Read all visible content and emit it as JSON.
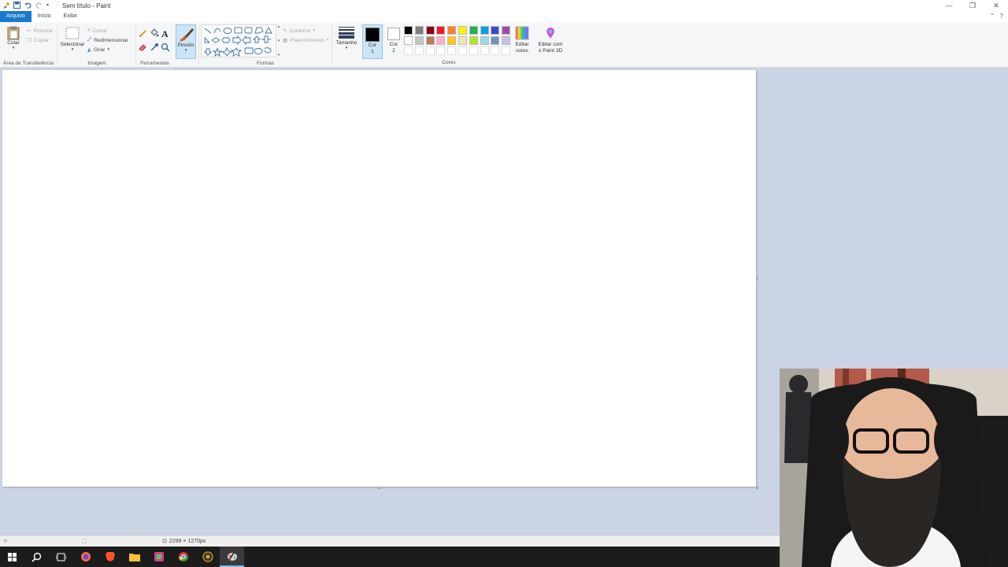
{
  "window": {
    "title": "Sem título - Paint"
  },
  "tabs": [
    {
      "label": "Arquivo"
    },
    {
      "label": "Início"
    },
    {
      "label": "Exibir"
    }
  ],
  "ribbon": {
    "clipboard": {
      "paste_label": "Colar",
      "cut_label": "Recortar",
      "copy_label": "Copiar",
      "group_label": "Área de Transferência"
    },
    "image": {
      "select_label": "Selecionar",
      "crop_label": "Cortar",
      "resize_label": "Redimensionar",
      "rotate_label": "Girar",
      "group_label": "Imagem"
    },
    "tools": {
      "group_label": "Ferramentas",
      "brushes_label": "Pincéis"
    },
    "shapes": {
      "outline_label": "Contorno",
      "fill_label": "Preenchimento",
      "group_label": "Formas"
    },
    "size_label": "Tamanho",
    "color1_label": "Cor\n1",
    "color2_label": "Cor\n2",
    "colors_group_label": "Cores",
    "edit_colors_label": "Editar\ncores",
    "paint3d_label": "Editar com\no Paint 3D"
  },
  "palette": {
    "color1": "#000000",
    "color2": "#ffffff",
    "swatches": [
      "#000000",
      "#7f7f7f",
      "#880015",
      "#ed1c24",
      "#ff7f27",
      "#fff200",
      "#22b14c",
      "#00a2e8",
      "#3f48cc",
      "#a349a4",
      "#ffffff",
      "#c3c3c3",
      "#b97a57",
      "#ffaec9",
      "#ffc90e",
      "#efe4b0",
      "#b5e61d",
      "#99d9ea",
      "#7092be",
      "#c8bfe7",
      "#ffffff",
      "#ffffff",
      "#ffffff",
      "#ffffff",
      "#ffffff",
      "#ffffff",
      "#ffffff",
      "#ffffff",
      "#ffffff",
      "#ffffff"
    ]
  },
  "statusbar": {
    "canvas_size": "2299 × 1270px"
  },
  "colors": {
    "accent": "#1979ca",
    "workspace": "#cbd4e4"
  },
  "taskbar": {
    "apps": [
      "start-icon",
      "search-icon",
      "task-view-icon",
      "firefox-icon",
      "brave-icon",
      "file-explorer-icon",
      "game-icon",
      "chrome-icon",
      "obs-icon",
      "paint-icon"
    ]
  }
}
